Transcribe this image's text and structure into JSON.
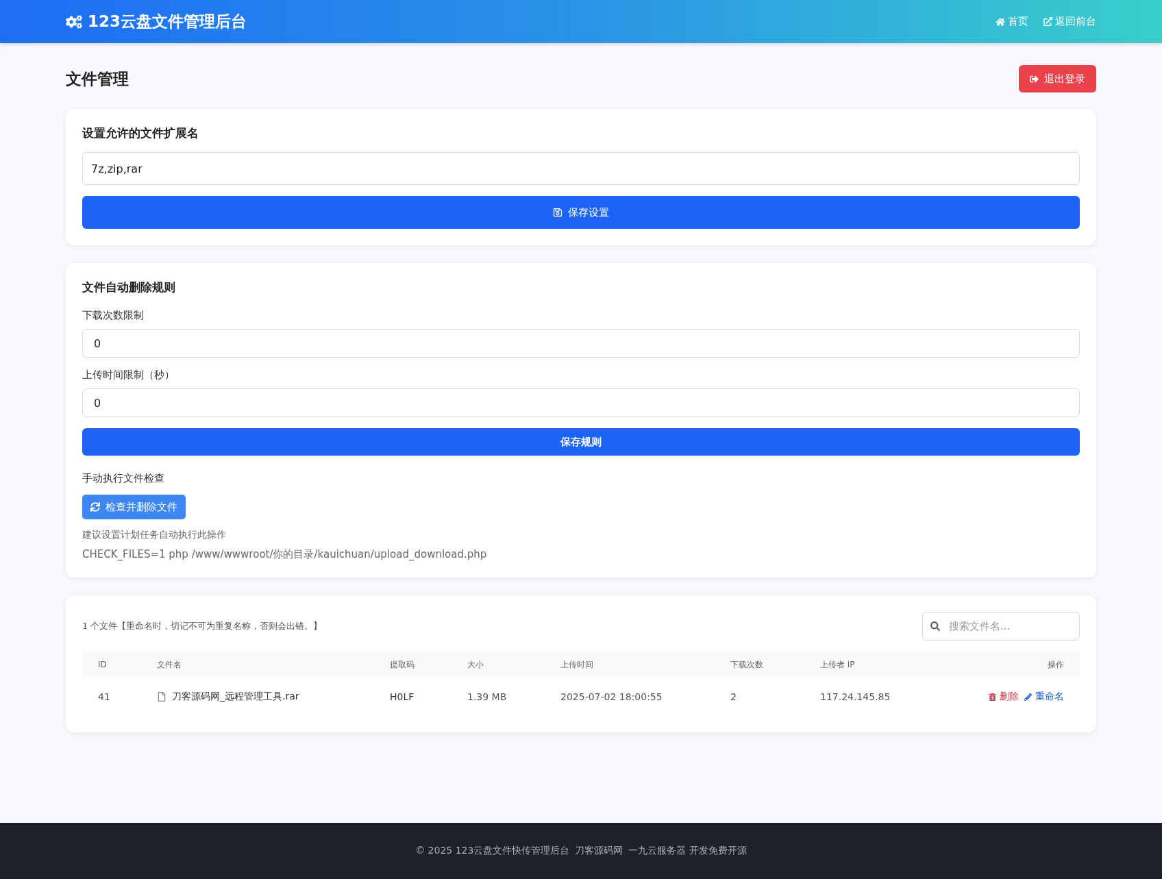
{
  "header": {
    "title": "123云盘文件管理后台",
    "nav": [
      {
        "kind": "home",
        "label": "首页"
      },
      {
        "kind": "external",
        "label": "返回前台"
      }
    ]
  },
  "page": {
    "title": "文件管理",
    "logout": "退出登录"
  },
  "extensions": {
    "title": "设置允许的文件扩展名",
    "value": "7z,zip,rar",
    "button": "保存设置"
  },
  "rules": {
    "title": "文件自动删除规则",
    "fields": [
      {
        "label": "下载次数限制",
        "value": "0"
      },
      {
        "label": "上传时间限制（秒）",
        "value": "0"
      }
    ],
    "button": "保存规则",
    "manual_label": "手动执行文件检查",
    "manual_button": "检查并删除文件",
    "hint": "建议设置计划任务自动执行此操作",
    "command": "CHECK_FILES=1 php /www/wwwroot/你的目录/kauichuan/upload_download.php"
  },
  "files": {
    "summary": "1 个文件【重命名时，切记不可为重复名称，否则会出错。】",
    "search": {
      "placeholder": "搜索文件名..."
    },
    "columns": [
      "ID",
      "文件名",
      "提取码",
      "大小",
      "上传时间",
      "下载次数",
      "上传者 IP",
      "操作"
    ],
    "rows": [
      {
        "id": "41",
        "name": "刀客源码网_远程管理工具.rar",
        "code": "H0LF",
        "size": "1.39 MB",
        "time": "2025-07-02 18:00:55",
        "downloads": "2",
        "ip": "117.24.145.85",
        "actions": [
          {
            "kind": "delete",
            "label": "删除"
          },
          {
            "kind": "rename",
            "label": "重命名"
          }
        ]
      }
    ]
  },
  "footer": [
    "© 2025 123云盘文件快传管理后台",
    "刀客源码网",
    "一九云服务器 开发免费开源"
  ]
}
